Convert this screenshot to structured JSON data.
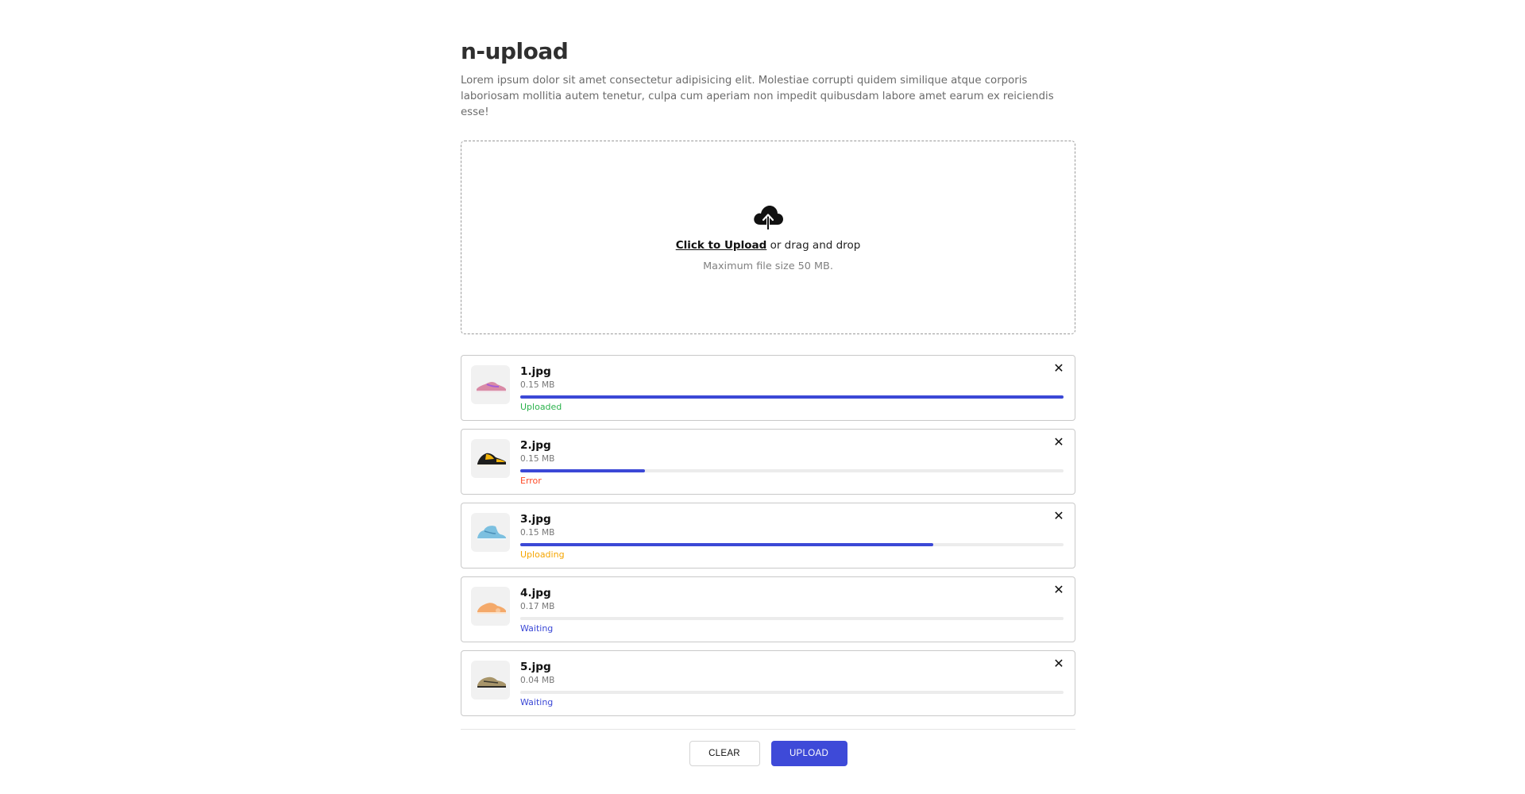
{
  "page": {
    "title": "n-upload",
    "description": "Lorem ipsum dolor sit amet consectetur adipisicing elit. Molestiae corrupti quidem similique atque corporis laboriosam mollitia autem tenetur, culpa cum aperiam non impedit quibusdam labore amet earum ex reiciendis esse!"
  },
  "dropzone": {
    "icon": "cloud-upload-icon",
    "link_label": "Click to Upload",
    "suffix_text": " or drag and drop",
    "hint": "Maximum file size 50 MB."
  },
  "files": [
    {
      "name": "1.jpg",
      "size": "0.15 MB",
      "progress_percent": 100,
      "status": "Uploaded",
      "status_color": "#2bb24c",
      "thumb": "pink-sneaker"
    },
    {
      "name": "2.jpg",
      "size": "0.15 MB",
      "progress_percent": 23,
      "status": "Error",
      "status_color": "#ff4a26",
      "thumb": "black-yellow-sneaker"
    },
    {
      "name": "3.jpg",
      "size": "0.15 MB",
      "progress_percent": 76,
      "status": "Uploading",
      "status_color": "#f5a500",
      "thumb": "blue-high-top-sneaker"
    },
    {
      "name": "4.jpg",
      "size": "0.17 MB",
      "progress_percent": 0,
      "status": "Waiting",
      "status_color": "#3b48d6",
      "thumb": "orange-sneaker"
    },
    {
      "name": "5.jpg",
      "size": "0.04 MB",
      "progress_percent": 0,
      "status": "Waiting",
      "status_color": "#3b48d6",
      "thumb": "olive-sneaker"
    }
  ],
  "actions": {
    "clear_label": "CLEAR",
    "upload_label": "UPLOAD"
  },
  "colors": {
    "accent": "#3e4ad8",
    "progress_fill": "#3b48d6",
    "progress_track": "#ececec"
  }
}
